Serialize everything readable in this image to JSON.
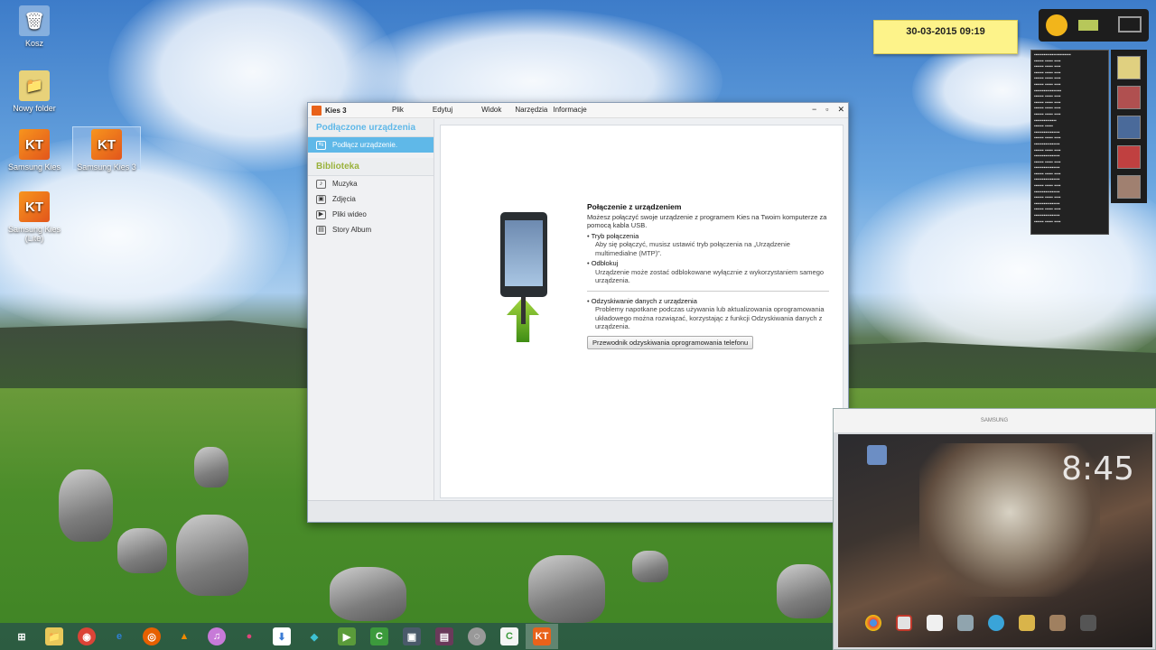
{
  "desktop": {
    "icons": [
      {
        "label": "Kosz",
        "glyph": "🗑"
      },
      {
        "label": "Nowy folder",
        "glyph": "📁"
      },
      {
        "label": "Samsung Kies",
        "glyph": "KT"
      },
      {
        "label": "Samsung Kies 3",
        "glyph": "KT"
      },
      {
        "label": "Samsung Kies (Lite)",
        "glyph": "KT"
      }
    ]
  },
  "clock": {
    "datetime": "30-03-2015 09:19"
  },
  "kies": {
    "title": "Kies 3",
    "menu": [
      "Plik",
      "Edytuj",
      "Widok",
      "Narzędzia",
      "Informacje"
    ],
    "sidebar": {
      "connected_header": "Podłączone urządzenia",
      "connect_item": "Podłącz urządzenie.",
      "library_header": "Biblioteka",
      "library_items": [
        "Muzyka",
        "Zdjęcia",
        "Pliki wideo",
        "Story Album"
      ]
    },
    "info": {
      "title": "Połączenie z urządzeniem",
      "intro": "Możesz połączyć swoje urządzenie z programem Kies na Twoim komputerze za pomocą kabla USB.",
      "mode_title": "Tryb połączenia",
      "mode_text": "Aby się połączyć, musisz ustawić tryb połączenia na „Urządzenie multimedialne (MTP)”.",
      "unlock_title": "Odblokuj",
      "unlock_text": "Urządzenie może zostać odblokowane wyłącznie z wykorzystaniem samego urządzenia.",
      "recovery_title": "Odzyskiwanie danych z urządzenia",
      "recovery_text": "Problemy napotkane podczas używania lub aktualizowania oprogramowania układowego można rozwiązać, korzystając z funkcji Odzyskiwania danych z urządzenia.",
      "guide_button": "Przewodnik odzyskiwania oprogramowania telefonu"
    }
  },
  "mirror": {
    "brand": "SAMSUNG",
    "time": "8:45"
  },
  "taskbar": {
    "items": [
      "⊞",
      "📁",
      "◉",
      "e",
      "◎",
      "▲",
      "♫",
      "●",
      "⬇",
      "◆",
      "▶",
      "C",
      "▣",
      "▤",
      "◌",
      "C",
      "KT"
    ]
  },
  "colors": {
    "accent": "#5fb8e8",
    "library_green": "#9ab23c",
    "kies_orange": "#e9621a"
  }
}
